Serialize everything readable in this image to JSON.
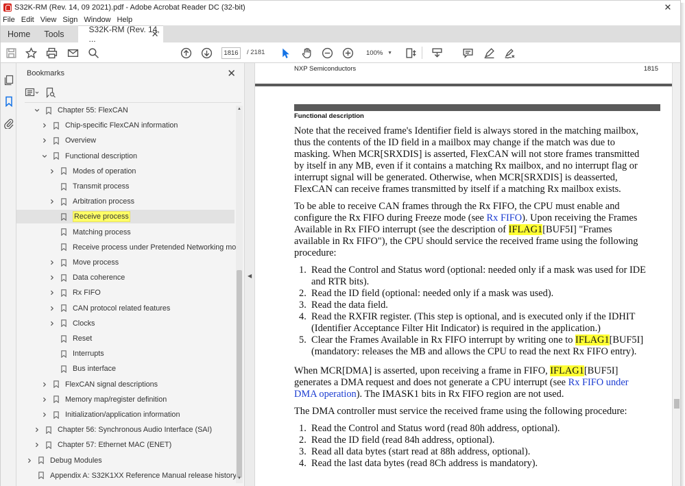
{
  "window": {
    "title": "S32K-RM (Rev. 14, 09 2021).pdf - Adobe Acrobat Reader DC (32-bit)",
    "close_glyph": "✕"
  },
  "menu": [
    "File",
    "Edit",
    "View",
    "Sign",
    "Window",
    "Help"
  ],
  "tabs": {
    "home": "Home",
    "tools": "Tools",
    "document": "S32K-RM (Rev. 14, ...",
    "document_close": "✕"
  },
  "toolbar": {
    "current_page": "1816",
    "total_pages": "/ 2181",
    "zoom": "100%",
    "icons": [
      "save-icon",
      "star-icon",
      "print-icon",
      "email-icon",
      "search-icon",
      "page-up-icon",
      "page-down-icon",
      "select-cursor-icon",
      "hand-icon",
      "zoom-out-icon",
      "zoom-in-icon",
      "fit-page-icon",
      "scroll-mode-icon",
      "comment-icon",
      "highlight-icon",
      "sign-icon"
    ]
  },
  "bookmarks": {
    "title": "Bookmarks",
    "close": "✕",
    "items": [
      {
        "label": "Chapter 55: FlexCAN",
        "level": 1,
        "chevron": "down"
      },
      {
        "label": "Chip-specific FlexCAN information",
        "level": 2,
        "chevron": "right"
      },
      {
        "label": "Overview",
        "level": 2,
        "chevron": "right"
      },
      {
        "label": "Functional description",
        "level": 2,
        "chevron": "down"
      },
      {
        "label": "Modes of operation",
        "level": 3,
        "chevron": "right"
      },
      {
        "label": "Transmit process",
        "level": 3,
        "chevron": "none"
      },
      {
        "label": "Arbitration process",
        "level": 3,
        "chevron": "right"
      },
      {
        "label": "Receive process",
        "level": 3,
        "chevron": "none",
        "selected": true
      },
      {
        "label": "Matching process",
        "level": 3,
        "chevron": "none"
      },
      {
        "label": "Receive process under Pretended Networking mode",
        "level": 3,
        "chevron": "none"
      },
      {
        "label": "Move process",
        "level": 3,
        "chevron": "right"
      },
      {
        "label": "Data coherence",
        "level": 3,
        "chevron": "right"
      },
      {
        "label": "Rx FIFO",
        "level": 3,
        "chevron": "right"
      },
      {
        "label": "CAN protocol related features",
        "level": 3,
        "chevron": "right"
      },
      {
        "label": "Clocks",
        "level": 3,
        "chevron": "right"
      },
      {
        "label": "Reset",
        "level": 3,
        "chevron": "none"
      },
      {
        "label": "Interrupts",
        "level": 3,
        "chevron": "none"
      },
      {
        "label": "Bus interface",
        "level": 3,
        "chevron": "none"
      },
      {
        "label": "FlexCAN signal descriptions",
        "level": 2,
        "chevron": "right"
      },
      {
        "label": "Memory map/register definition",
        "level": 2,
        "chevron": "right"
      },
      {
        "label": "Initialization/application information",
        "level": 2,
        "chevron": "right"
      },
      {
        "label": "Chapter 56: Synchronous Audio Interface (SAI)",
        "level": 1,
        "chevron": "right"
      },
      {
        "label": "Chapter 57: Ethernet MAC (ENET)",
        "level": 1,
        "chevron": "right"
      },
      {
        "label": "Debug Modules",
        "level": 0,
        "chevron": "right"
      },
      {
        "label": "Appendix A: S32K1XX Reference Manual release history",
        "level": 0,
        "chevron": "none"
      }
    ]
  },
  "page": {
    "header_left": "NXP Semiconductors",
    "header_right": "1815",
    "section": "Functional description",
    "p1": [
      "Note that the received frame's Identifier field is always stored in the matching mailbox,",
      "thus the contents of the ID field in a mailbox may change if the match was due to",
      "masking. When MCR[SRXDIS] is asserted, FlexCAN will not store frames transmitted",
      "by itself in any MB, even if it contains a matching Rx mailbox, and no interrupt flag or",
      "interrupt signal will be generated. Otherwise, when MCR[SRXDIS] is deasserted,",
      "FlexCAN can receive frames transmitted by itself if a matching Rx mailbox exists."
    ],
    "p2": {
      "l1": "To be able to receive CAN frames through the Rx FIFO, the CPU must enable and",
      "l2a": "configure the Rx FIFO during Freeze mode (see ",
      "l2link": "Rx FIFO",
      "l2b": "). Upon receiving the Frames",
      "l3a": "Available in Rx FIFO interrupt (see the description of ",
      "l3hl": "IFLAG1",
      "l3b": "[BUF5I] \"Frames",
      "l4": "available in Rx FIFO\"), the CPU should service the received frame using the following",
      "l5": "procedure:"
    },
    "list1": {
      "i1n": "1.",
      "i1a": "Read the Control and Status word (optional: needed only if a mask was used for IDE",
      "i1b": "and RTR bits).",
      "i2n": "2.",
      "i2": "Read the ID field (optional: needed only if a mask was used).",
      "i3n": "3.",
      "i3": "Read the data field.",
      "i4n": "4.",
      "i4a": "Read the RXFIR register. (This step is optional, and is executed only if the IDHIT",
      "i4b": "(Identifier Acceptance Filter Hit Indicator) is required in the application.)",
      "i5n": "5.",
      "i5a": "Clear the Frames Available in Rx FIFO interrupt by writing one to ",
      "i5hl": "IFLAG1",
      "i5b": "[BUF5I]",
      "i5c": "(mandatory: releases the MB and allows the CPU to read the next Rx FIFO entry)."
    },
    "p3": {
      "l1a": "When MCR[DMA] is asserted, upon receiving a frame in FIFO, ",
      "l1hl": "IFLAG1",
      "l1b": "[BUF5I]",
      "l2a": "generates a DMA request and does not generate a CPU interrupt (see ",
      "l2link": "Rx FIFO under",
      "l3link": "DMA operation",
      "l3b": "). The IMASK1 bits in Rx FIFO region are not used."
    },
    "p4": "The DMA controller must service the received frame using the following procedure:",
    "list2": {
      "i1n": "1.",
      "i1": "Read the Control and Status word (read 80h address, optional).",
      "i2n": "2.",
      "i2": "Read the ID field (read 84h address, optional).",
      "i3n": "3.",
      "i3": "Read all data bytes (start read at 88h address, optional).",
      "i4n": "4.",
      "i4": "Read the last data bytes (read 8Ch address is mandatory)."
    }
  },
  "colors": {
    "accent": "#1473e6",
    "highlight": "#ffff33",
    "link": "#1a3bd1"
  }
}
